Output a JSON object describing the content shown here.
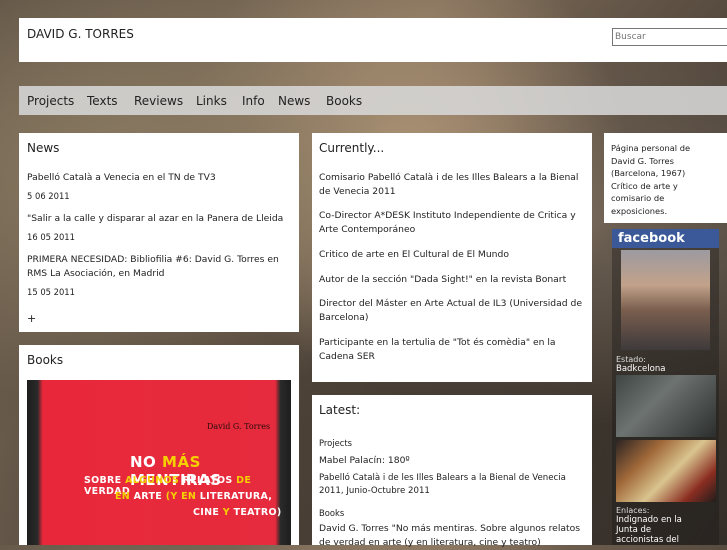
{
  "header": {
    "title": "DAVID G. TORRES",
    "search_placeholder": "Buscar"
  },
  "nav": [
    "Projects",
    "Texts",
    "Reviews",
    "Links",
    "Info",
    "News",
    "Books"
  ],
  "news": {
    "title": "News",
    "items": [
      {
        "text": "Pabelló Català a Venecia en el TN de TV3",
        "date": "5 06 2011"
      },
      {
        "text": "\"Salir a la calle y disparar al azar en la Panera de Lleida",
        "date": "16 05 2011"
      },
      {
        "text_l1": "PRIMERA NECESIDAD: Bibliofilia #6: David G. Torres en",
        "text_l2": "RMS La Asociación, en Madrid",
        "date": "15 05 2011"
      }
    ],
    "more": "+"
  },
  "books": {
    "title": "Books",
    "cover": {
      "author": "David G. Torres",
      "l1_a": "NO ",
      "l1_b": "MÁS",
      "l1_c": " MENTIRAS",
      "l2_a": "SOBRE ",
      "l2_b": "ALGUNOS",
      "l2_c": " RELATOS ",
      "l2_d": "DE",
      "l2_e": " VERDAD",
      "l3_a": "EN",
      "l3_b": " ARTE ",
      "l3_c": "(Y EN",
      "l3_d": " LITERATURA,",
      "l4_a": "CINE ",
      "l4_b": "Y",
      "l4_c": " TEATRO)"
    }
  },
  "currently": {
    "title": "Currently...",
    "items": [
      [
        "Comisario Pabelló Català i de les Illes Balears a la Bienal",
        "de Venecia 2011"
      ],
      [
        "Co-Director A*DESK Instituto Independiente de Critica y",
        "Arte Contemporáneo"
      ],
      [
        "Critico de arte en El Cultural de El Mundo"
      ],
      [
        "Autor de la sección \"Dada Sight!\" en la revista Bonart"
      ],
      [
        "Director del Máster en Arte Actual de IL3 (Universidad de",
        "Barcelona)"
      ],
      [
        "Participante en la tertulia de \"Tot és comèdia\" en la",
        "Cadena SER"
      ]
    ]
  },
  "latest": {
    "title": "Latest:",
    "section1": "Projects",
    "p1": "Mabel Palacín: 180º",
    "p2_l1": "Pabelló Català i de les Illes Balears a la Bienal de Venecia",
    "p2_l2": "2011, Junio-Octubre 2011",
    "section2": "Books",
    "b1_l1": "David G. Torres \"No más mentiras. Sobre algunos relatos",
    "b1_l2": "de verdad en arte (y en literatura, cine y teatro)"
  },
  "sidebar": {
    "bio": [
      "Página personal de",
      "David G. Torres",
      "(Barcelona, 1967)",
      "Crítico de arte y",
      "comisario de",
      "exposiciones."
    ],
    "facebook": "facebook",
    "estado_label": "Estado:",
    "estado_value": "Badkcelona",
    "enlaces_label": "Enlaces:",
    "enlaces_l1": "Indignado en la",
    "enlaces_l2": "Junta de",
    "enlaces_l3": "accionistas del"
  }
}
